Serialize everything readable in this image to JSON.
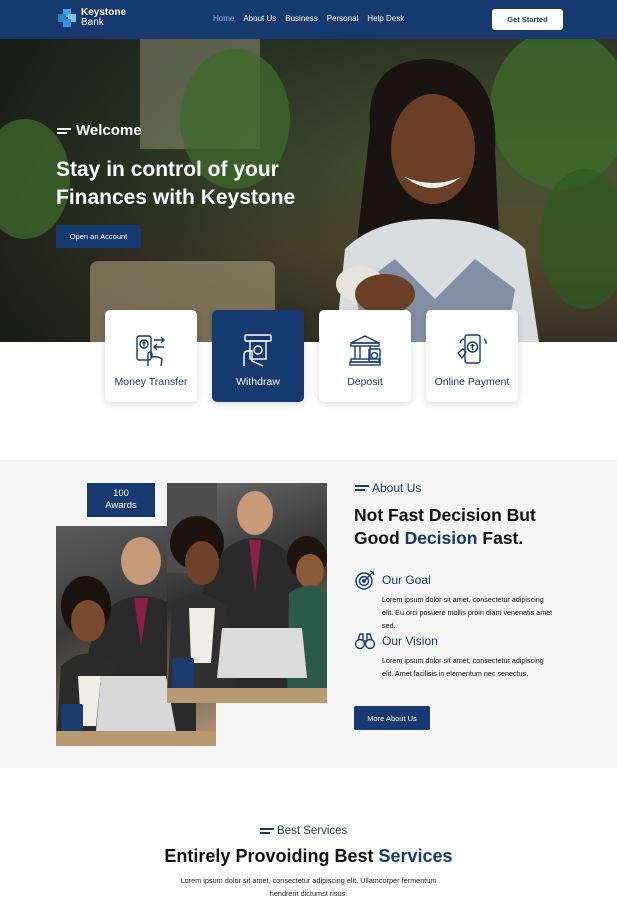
{
  "nav": {
    "logo_name": "Keystone",
    "logo_sub": "Bank",
    "links": [
      "Home",
      "About Us",
      "Business",
      "Personal",
      "Help Desk"
    ],
    "cta": "Get Started"
  },
  "hero": {
    "welcome": "Welcome",
    "title": "Stay in control of your Finances with Keystone",
    "cta": "Open an Account"
  },
  "services": [
    {
      "label": "Money Transfer",
      "icon": "money-transfer-icon"
    },
    {
      "label": "Withdraw",
      "icon": "atm-withdraw-icon"
    },
    {
      "label": "Deposit",
      "icon": "bank-deposit-icon"
    },
    {
      "label": "Online Payment",
      "icon": "mobile-payment-icon"
    }
  ],
  "about": {
    "awards_count": "100",
    "awards_label": "Awards",
    "tag": "About Us",
    "title_part1": "Not Fast Decision But Good",
    "title_highlight": "Decision",
    "title_part2": "Fast.",
    "goal_title": "Our Goal",
    "goal_text": "Lorem ipsum dolor sit amet, consectetur adipiscing elit. Eu orci posuere mollis proin diam venenatis amet sed.",
    "vision_title": "Our Vision",
    "vision_text": "Lorem ipsum dolor sit amet, consectetur adipiscing elit. Amet facilisis in elementum nec senectus.",
    "cta": "More About Us"
  },
  "best": {
    "tag": "Best Services",
    "title_part1": "Entirely Provoiding Best",
    "title_highlight": "Services",
    "text": "Lorem ipsum dolor sit amet, consectetur adipiscing elit. Ullamcorper fermentum hendrerit dictumst risus."
  },
  "colors": {
    "brand": "#163a70",
    "accent_link": "#7fb7ff",
    "section_bg": "#f5f5f5"
  }
}
